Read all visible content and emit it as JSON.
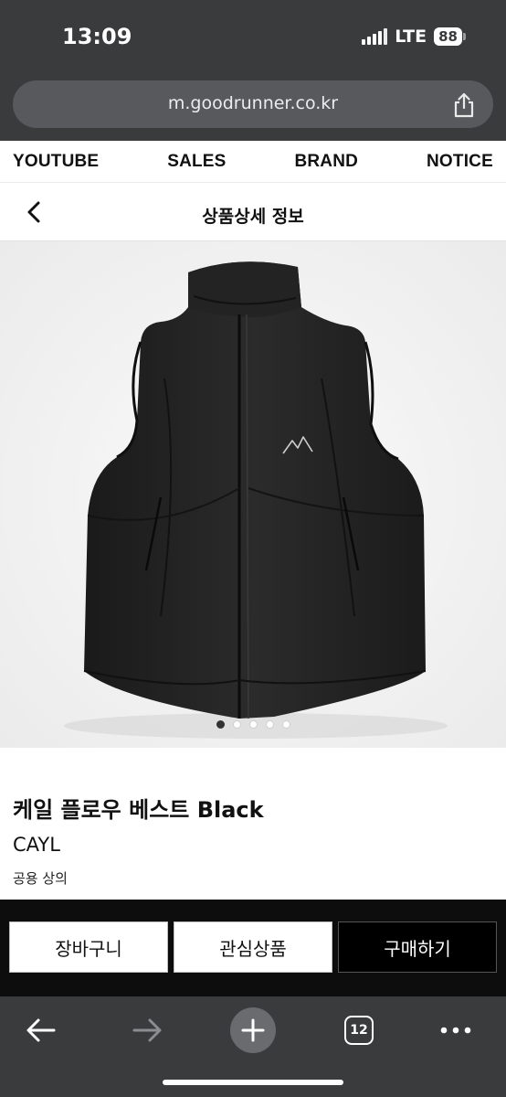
{
  "status_bar": {
    "time": "13:09",
    "network": "LTE",
    "battery": "88",
    "icons": [
      "signal-icon",
      "battery-icon"
    ]
  },
  "browser": {
    "url": "m.goodrunner.co.kr",
    "share_icon": "share-icon",
    "toolbar_icons": [
      "back-arrow-icon",
      "forward-arrow-icon",
      "plus-icon",
      "tabs-icon",
      "more-icon"
    ],
    "tab_count": "12"
  },
  "top_nav": {
    "items": [
      {
        "label": "YOUTUBE"
      },
      {
        "label": "SALES"
      },
      {
        "label": "BRAND"
      },
      {
        "label": "NOTICE"
      }
    ]
  },
  "page_header": {
    "title": "상품상세 정보",
    "back_icon": "chevron-left-icon"
  },
  "product": {
    "image_icon": "vest-image",
    "carousel": {
      "total": 5,
      "active": 0
    },
    "name": "케일 플로우 베스트 Black",
    "brand": "CAYL",
    "category": "공용 상의"
  },
  "actions": {
    "cart_label": "장바구니",
    "wish_label": "관심상품",
    "buy_label": "구매하기"
  },
  "colors": {
    "chrome": "#3a3b3d",
    "urlbar": "#58595c",
    "action_bar": "#0d0d0d",
    "buy_button": "#000000",
    "accent_text": "#111111"
  }
}
